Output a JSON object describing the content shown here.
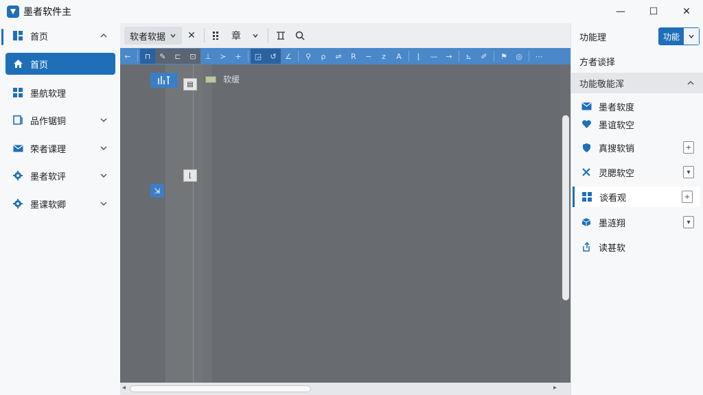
{
  "app": {
    "title": "墨者软件主"
  },
  "window": {
    "minimize": "—",
    "maximize": "☐",
    "close": "✕"
  },
  "sidebar": {
    "header": "首页",
    "items": [
      {
        "label": "首页",
        "icon": "home-icon"
      },
      {
        "label": "墨航软理",
        "icon": "grid-icon"
      },
      {
        "label": "品作锯铜",
        "icon": "document-icon"
      },
      {
        "label": "荣者课理",
        "icon": "mail-icon"
      },
      {
        "label": "墨者软评",
        "icon": "gear-icon"
      },
      {
        "label": "墨课软卿",
        "icon": "gear-icon"
      }
    ]
  },
  "toolbar": {
    "tab_label": "软者软据",
    "icon_labels": [
      "章"
    ]
  },
  "canvas": {
    "node_label": "软缓"
  },
  "right_panel": {
    "title": "功能理",
    "select_value": "功能",
    "subtitle": "方者谈择",
    "section_title": "功能敬能浑",
    "items": [
      {
        "label": "墨者软度",
        "icon": "mail-icon",
        "has_box": false
      },
      {
        "label": "墨谊软空",
        "icon": "heart-icon",
        "has_box": false
      },
      {
        "label": "真搜软销",
        "icon": "shield-icon",
        "has_box": true
      },
      {
        "label": "灵腮软空",
        "icon": "tools-icon",
        "has_box": true
      },
      {
        "label": "谈看观",
        "icon": "grid-icon",
        "has_box": true
      },
      {
        "label": "墨涟翔",
        "icon": "cube-icon",
        "has_box": true
      },
      {
        "label": "读甚软",
        "icon": "export-icon",
        "has_box": false
      }
    ]
  },
  "colors": {
    "accent": "#1f6fb8",
    "canvas": "#686b6f",
    "toolbar_blue": "#4a88c9"
  }
}
